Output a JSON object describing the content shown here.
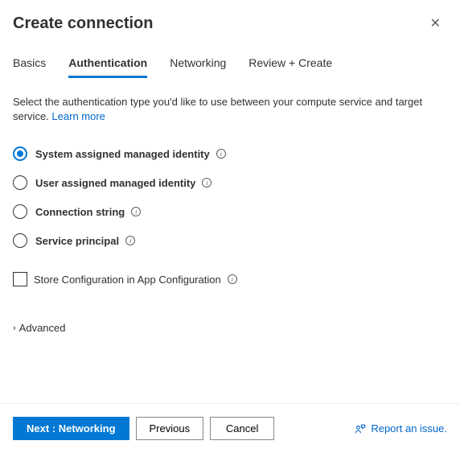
{
  "header": {
    "title": "Create connection"
  },
  "tabs": [
    {
      "label": "Basics",
      "active": false
    },
    {
      "label": "Authentication",
      "active": true
    },
    {
      "label": "Networking",
      "active": false
    },
    {
      "label": "Review + Create",
      "active": false
    }
  ],
  "description": {
    "text": "Select the authentication type you'd like to use between your compute service and target service.",
    "learn_more": "Learn more"
  },
  "auth_options": [
    {
      "label": "System assigned managed identity",
      "selected": true
    },
    {
      "label": "User assigned managed identity",
      "selected": false
    },
    {
      "label": "Connection string",
      "selected": false
    },
    {
      "label": "Service principal",
      "selected": false
    }
  ],
  "checkbox": {
    "label": "Store Configuration in App Configuration",
    "checked": false
  },
  "advanced": {
    "label": "Advanced"
  },
  "footer": {
    "next": "Next : Networking",
    "previous": "Previous",
    "cancel": "Cancel",
    "report": "Report an issue."
  }
}
